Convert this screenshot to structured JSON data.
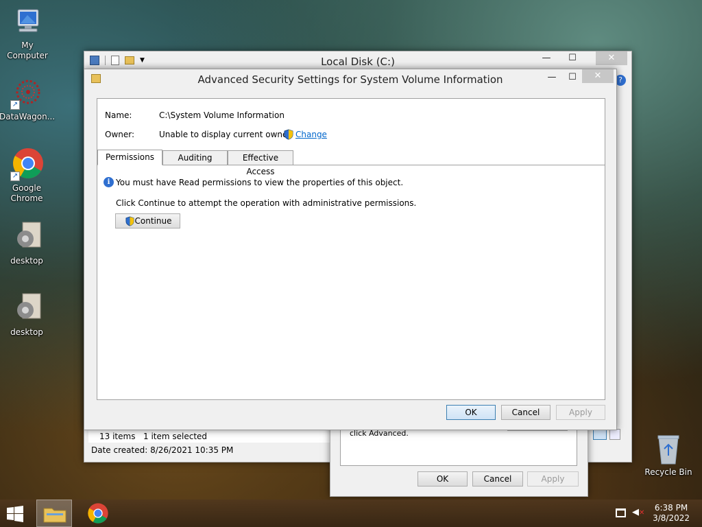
{
  "desktop": {
    "icons": [
      {
        "label": "My Computer",
        "icon": "computer-icon"
      },
      {
        "label": "DataWagon...",
        "icon": "datawagon-icon"
      },
      {
        "label": "Google Chrome",
        "icon": "chrome-icon"
      },
      {
        "label": "desktop",
        "icon": "file-gear-icon"
      },
      {
        "label": "desktop",
        "icon": "file-gear-icon"
      },
      {
        "label": "Recycle Bin",
        "icon": "recycle-bin-icon"
      }
    ]
  },
  "explorer": {
    "title": "Local Disk (C:)",
    "status_items": "13 items",
    "status_selected": "1 item selected",
    "date_created": "Date created: 8/26/2021 10:35 PM"
  },
  "properties_dialog": {
    "text_fragment": "click Advanced.",
    "ok": "OK",
    "cancel": "Cancel",
    "apply": "Apply"
  },
  "advanced_dialog": {
    "title": "Advanced Security Settings for System Volume Information",
    "name_label": "Name:",
    "name_value": "C:\\System Volume Information",
    "owner_label": "Owner:",
    "owner_value": "Unable to display current owner.",
    "change_link": "Change",
    "tabs": [
      {
        "label": "Permissions",
        "active": true
      },
      {
        "label": "Auditing",
        "active": false
      },
      {
        "label": "Effective Access",
        "active": false
      }
    ],
    "info_message": "You must have Read permissions to view the properties of this object.",
    "continue_hint": "Click Continue to attempt the operation with administrative permissions.",
    "continue_button": "Continue",
    "ok": "OK",
    "cancel": "Cancel",
    "apply": "Apply"
  },
  "taskbar": {
    "time": "6:38 PM",
    "date": "3/8/2022"
  }
}
